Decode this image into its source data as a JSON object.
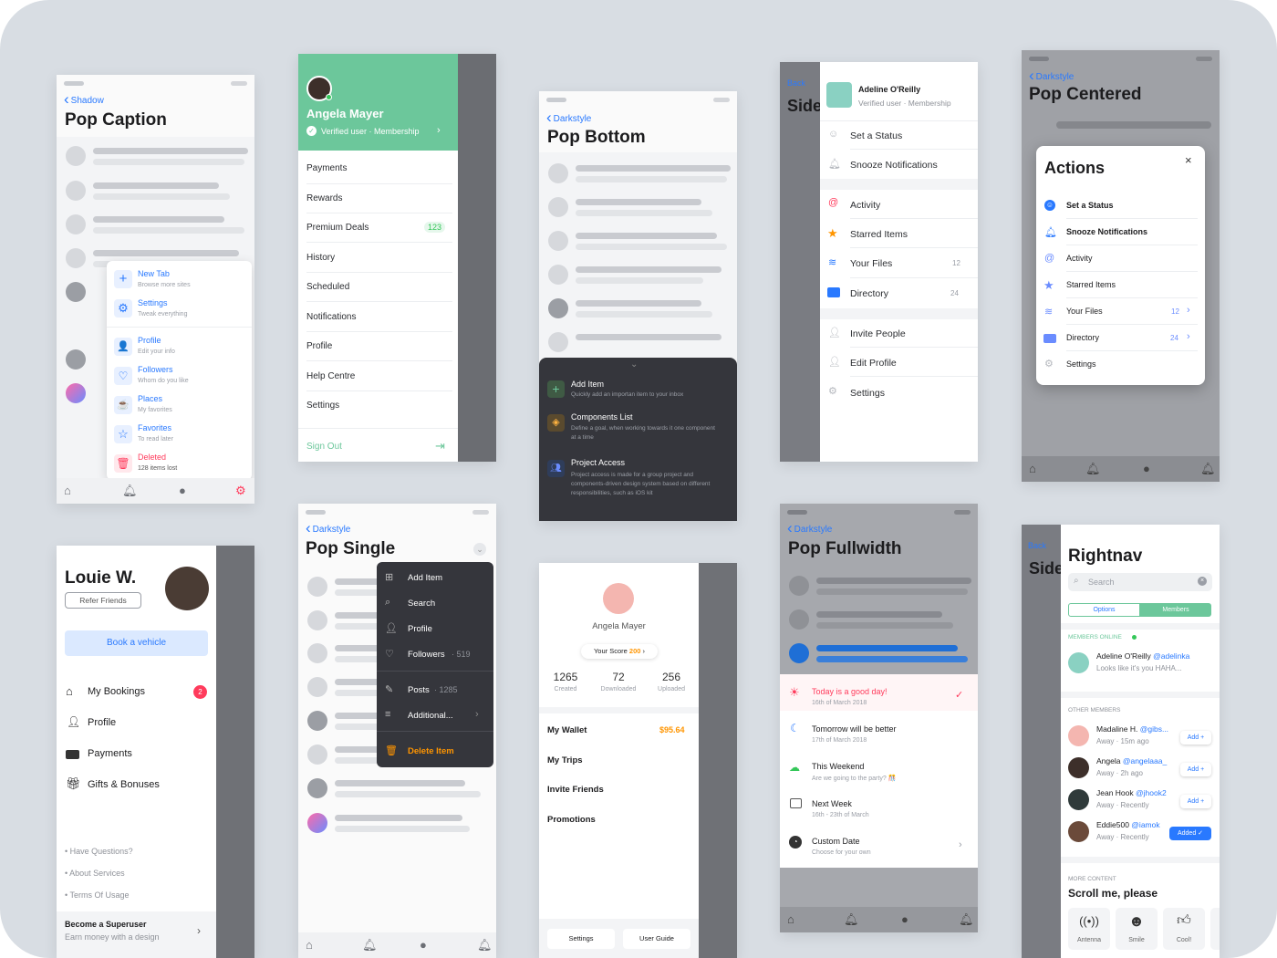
{
  "s1": {
    "back": "Shadow",
    "title": "Pop Caption",
    "items": [
      {
        "title": "New Tab",
        "sub": "Browse more sites"
      },
      {
        "title": "Settings",
        "sub": "Tweak everything"
      },
      {
        "title": "Profile",
        "sub": "Edit your info"
      },
      {
        "title": "Followers",
        "sub": "Whom do you like"
      },
      {
        "title": "Places",
        "sub": "My favorites"
      },
      {
        "title": "Favorites",
        "sub": "To read later"
      },
      {
        "title": "Deleted",
        "sub": "128 items lost"
      }
    ]
  },
  "s2": {
    "name": "Angela Mayer",
    "verified": "Verified user · Membership",
    "items": [
      "Payments",
      "Rewards",
      "Premium Deals",
      "History",
      "Scheduled",
      "Notifications",
      "Profile",
      "Help Centre",
      "Settings"
    ],
    "premium_badge": "123",
    "signout": "Sign Out"
  },
  "s3": {
    "back": "Darkstyle",
    "title": "Pop Bottom",
    "items": [
      {
        "title": "Add Item",
        "sub": "Quickly add an importan item to your inbox"
      },
      {
        "title": "Components List",
        "sub": "Define a goal, when working towards it one component at a time"
      },
      {
        "title": "Project Access",
        "sub": "Project access is made for a group project and components-driven design system based on different responsibilities, such as iOS kit"
      }
    ]
  },
  "s4": {
    "back": "Back",
    "peek": "Side",
    "name": "Adeline O'Reilly",
    "verified": "Verified user · Membership",
    "items": [
      "Set a Status",
      "Snooze Notifications",
      "Activity",
      "Starred Items",
      "Your Files",
      "Directory",
      "Invite People",
      "Edit Profile",
      "Settings"
    ],
    "files_count": "12",
    "dir_count": "24"
  },
  "s5": {
    "back": "Darkstyle",
    "title": "Pop Centered",
    "sheet_title": "Actions",
    "close": "×",
    "items": [
      "Set a Status",
      "Snooze Notifications",
      "Activity",
      "Starred Items",
      "Your Files",
      "Directory",
      "Settings"
    ],
    "files_count": "12",
    "dir_count": "24"
  },
  "s6": {
    "name": "Louie W.",
    "refer": "Refer Friends",
    "book": "Book a vehicle",
    "items": [
      "My Bookings",
      "Profile",
      "Payments",
      "Gifts & Bonuses"
    ],
    "badge": "2",
    "links": [
      "• Have Questions?",
      "• About Services",
      "• Terms Of Usage"
    ],
    "footer_title": "Become a Superuser",
    "footer_sub": "Earn money with a design"
  },
  "s7": {
    "back": "Darkstyle",
    "title": "Pop Single",
    "menu": [
      "Add Item",
      "Search",
      "Profile",
      "Followers",
      "Posts",
      "Additional...",
      "Delete Item"
    ],
    "followers_count": "· 519",
    "posts_count": "· 1285"
  },
  "s8": {
    "name": "Angela Mayer",
    "score_label": "Your Score",
    "score": "200",
    "stats": [
      {
        "n": "1265",
        "l": "Created"
      },
      {
        "n": "72",
        "l": "Downloaded"
      },
      {
        "n": "256",
        "l": "Uploaded"
      }
    ],
    "wallet": "My Wallet",
    "wallet_amount": "$95.64",
    "items": [
      "My Trips",
      "Invite Friends",
      "Promotions"
    ],
    "btn1": "Settings",
    "btn2": "User Guide"
  },
  "s9": {
    "back": "Darkstyle",
    "title": "Pop Fullwidth",
    "items": [
      {
        "title": "Today is a good day!",
        "sub": "16th of March 2018"
      },
      {
        "title": "Tomorrow will be better",
        "sub": "17th of March 2018"
      },
      {
        "title": "This Weekend",
        "sub": "Are we going to the party? 🎊"
      },
      {
        "title": "Next Week",
        "sub": "16th - 23th of March"
      },
      {
        "title": "Custom Date",
        "sub": "Choose for your own"
      }
    ]
  },
  "s10": {
    "back": "Back",
    "peek": "Side",
    "title": "Rightnav",
    "search": "Search",
    "seg": [
      "Options",
      "Members"
    ],
    "online_label": "MEMBERS ONLINE",
    "online": {
      "name": "Adeline O'Reilly",
      "handle": "@adelinka",
      "msg": "Looks like it's you HAHA..."
    },
    "other_label": "OTHER MEMBERS",
    "members": [
      {
        "name": "Madaline H.",
        "handle": "@gibs...",
        "status": "Away · 15m ago",
        "btn": "Add +"
      },
      {
        "name": "Angela",
        "handle": "@angelaaa_",
        "status": "Away · 2h ago",
        "btn": "Add +"
      },
      {
        "name": "Jean Hook",
        "handle": "@jhook2",
        "status": "Away · Recently",
        "btn": "Add +"
      },
      {
        "name": "Eddie500",
        "handle": "@iamok",
        "status": "Away · Recently",
        "btn": "Added ✓"
      }
    ],
    "more_label": "MORE CONTENT",
    "scroll": "Scroll me, please",
    "cards": [
      "Antenna",
      "Smile",
      "Cool!"
    ]
  },
  "colors": {
    "accent": "#2979ff",
    "green": "#6cc79b",
    "red": "#ff3b5c",
    "orange": "#ff9500"
  }
}
